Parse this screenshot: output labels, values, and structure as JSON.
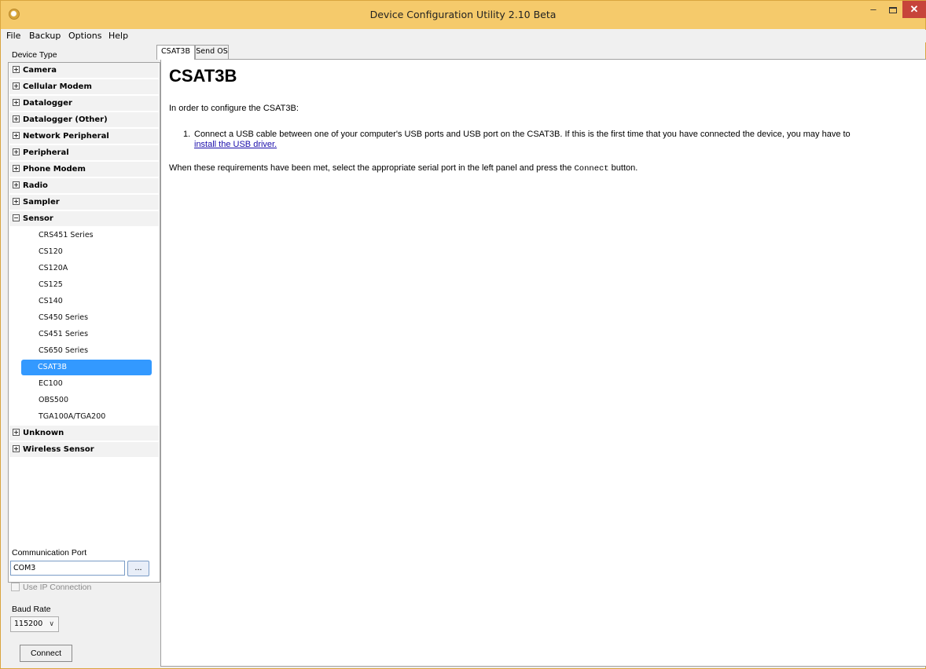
{
  "window": {
    "title": "Device Configuration Utility 2.10 Beta",
    "minimize_glyph": "–",
    "close_glyph": "✕"
  },
  "menu": [
    "File",
    "Backup",
    "Options",
    "Help"
  ],
  "left_panel": {
    "device_type_label": "Device Type",
    "categories": [
      {
        "label": "Camera",
        "expanded": false
      },
      {
        "label": "Cellular Modem",
        "expanded": false
      },
      {
        "label": "Datalogger",
        "expanded": false
      },
      {
        "label": "Datalogger (Other)",
        "expanded": false
      },
      {
        "label": "Network Peripheral",
        "expanded": false
      },
      {
        "label": "Peripheral",
        "expanded": false
      },
      {
        "label": "Phone Modem",
        "expanded": false
      },
      {
        "label": "Radio",
        "expanded": false
      },
      {
        "label": "Sampler",
        "expanded": false
      },
      {
        "label": "Sensor",
        "expanded": true
      },
      {
        "label": "Unknown",
        "expanded": false
      },
      {
        "label": "Wireless Sensor",
        "expanded": false
      }
    ],
    "sensor_children": [
      "CRS451 Series",
      "CS120",
      "CS120A",
      "CS125",
      "CS140",
      "CS450 Series",
      "CS451 Series",
      "CS650 Series",
      "CSAT3B",
      "EC100",
      "OBS500",
      "TGA100A/TGA200"
    ],
    "selected_child": "CSAT3B",
    "communication_port_label": "Communication Port",
    "communication_port_value": "COM3",
    "browse_label": "...",
    "use_ip_label": "Use IP Connection",
    "use_ip_checked": false,
    "baud_rate_label": "Baud Rate",
    "baud_rate_value": "115200",
    "connect_label": "Connect"
  },
  "tabs": [
    {
      "label": "CSAT3B",
      "active": true
    },
    {
      "label": "Send OS",
      "active": false
    }
  ],
  "content": {
    "heading": "CSAT3B",
    "intro": "In order to configure the CSAT3B:",
    "step_number": "1.",
    "step_text": "Connect a USB cable between one of your computer's USB ports and USB port on the CSAT3B. If this is the first time that you have connected the device, you may have to",
    "step_link": "install the USB driver.",
    "requirements_before": "When these requirements have been met, select the appropriate serial port in the left panel and press the",
    "requirements_code": "Connect",
    "requirements_after": "button."
  },
  "colors": {
    "titlebar": "#f5ca6b",
    "selection": "#3399ff",
    "close_button": "#c7443a",
    "link": "#1a0dab"
  }
}
